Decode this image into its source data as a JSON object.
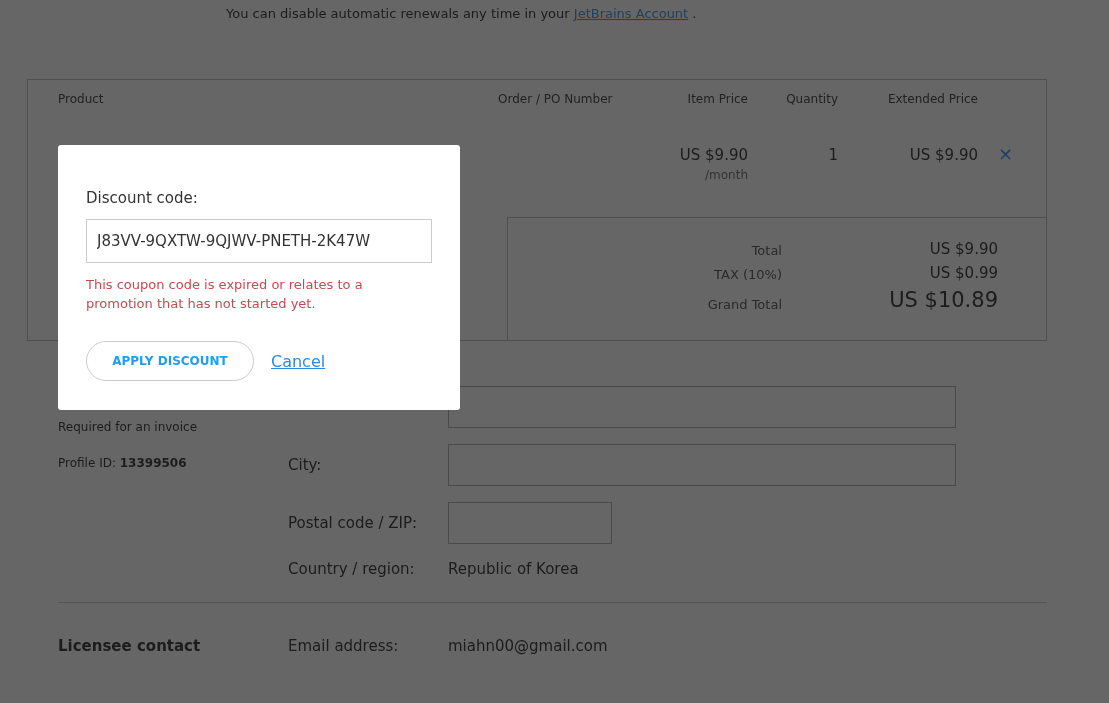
{
  "renewal_notice": {
    "text": "You can disable automatic renewals any time in your ",
    "link": "JetBrains Account",
    "suffix": "."
  },
  "order_table": {
    "columns": [
      "Product",
      "Order / PO Number",
      "Item Price",
      "Quantity",
      "Extended Price"
    ],
    "item": {
      "price": "US $9.90",
      "period": "/month",
      "quantity": "1",
      "extended": "US $9.90",
      "remove": "×"
    },
    "summary": [
      {
        "label": "Total",
        "value": "US $9.90",
        "kind": "normal"
      },
      {
        "label": "TAX (10%)",
        "value": "US $0.99",
        "kind": "normal"
      },
      {
        "label": "Grand Total",
        "value": "US $10.89",
        "kind": "grand"
      }
    ]
  },
  "licensee_information": {
    "subtitle": "Required for an invoice",
    "profile_label": "Profile ID: ",
    "profile_id": "13399506",
    "fields": [
      {
        "kind": "input"
      },
      {
        "label": "City:",
        "kind": "input"
      },
      {
        "label": "Postal code / ZIP:",
        "kind": "short_input"
      },
      {
        "label": "Country / region:",
        "kind": "text",
        "value": "Republic of Korea"
      }
    ]
  },
  "licensee_contact": {
    "title": "Licensee contact",
    "fields": [
      {
        "label": "Email address:",
        "kind": "text",
        "value": "miahn00@gmail.com"
      }
    ]
  },
  "discount_dialog": {
    "label": "Discount code:",
    "value": "J83VV-9QXTW-9QJWV-PNETH-2K47W",
    "error": "This coupon code is expired or relates to a promotion that has not started yet.",
    "apply": "APPLY DISCOUNT",
    "cancel": "Cancel"
  }
}
